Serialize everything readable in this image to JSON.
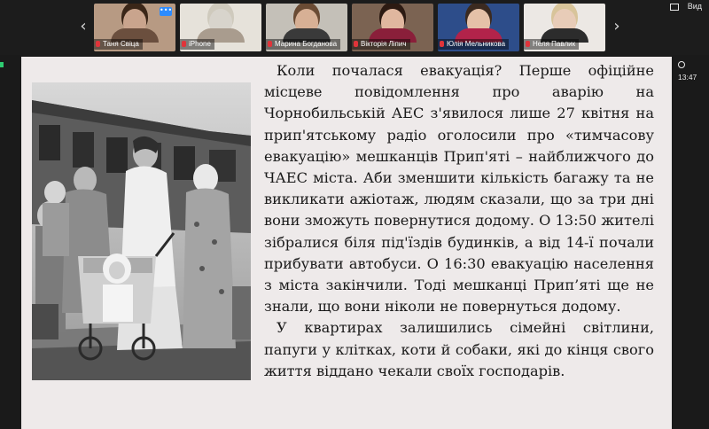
{
  "window": {
    "view_label": "Вид",
    "timer": "13:47"
  },
  "participants": [
    {
      "name": "Таня Свіца",
      "muted": true,
      "has_more_button": true,
      "skin": "#c9a48d",
      "hair": "#3a2618",
      "shirt": "#6b4f3e",
      "bg": "#b79a83"
    },
    {
      "name": "iPhone",
      "muted": true,
      "has_more_button": false,
      "skin": "#d8d4cc",
      "hair": "#cfcabd",
      "shirt": "#a99c8e",
      "bg": "#e6e2da"
    },
    {
      "name": "Марина Богданова",
      "muted": true,
      "has_more_button": false,
      "skin": "#d7b095",
      "hair": "#6a4b34",
      "shirt": "#3a3a3a",
      "bg": "#c4c0b8"
    },
    {
      "name": "Вікторія Ліпич",
      "muted": true,
      "has_more_button": false,
      "skin": "#e0b79f",
      "hair": "#2c1a12",
      "shirt": "#8a1f3a",
      "bg": "#7b6352"
    },
    {
      "name": "Юлія Мельникова",
      "muted": true,
      "has_more_button": false,
      "skin": "#e5c1a8",
      "hair": "#3b2a20",
      "shirt": "#b2234a",
      "bg": "#2d4d8a"
    },
    {
      "name": "Неля Павлик",
      "muted": true,
      "has_more_button": false,
      "skin": "#e8ccb8",
      "hair": "#d8c49a",
      "shirt": "#2c2c2c",
      "bg": "#ece8e4"
    }
  ],
  "slide": {
    "photo_description_icon": "black-and-white-photo",
    "paragraphs": [
      "Коли почалася евакуація? Перше офіційне місцеве повідомлення про аварію на Чорнобильській АЕС з'явилося лише 27 квітня на прип'ятському радіо оголосили про «тимчасову евакуацію» мешканців Прип'яті – найближчого до ЧАЕС міста. Аби зменшити кількість багажу та не викликати ажіотаж, людям сказали, що за три дні вони зможуть повернутися додому. О 13:50 жителі зібралися біля під'їздів будинків, а від 14-ї почали прибувати автобуси. О 16:30 евакуацію населення з міста закінчили. Тоді мешканці Прип’яті ще не знали, що вони ніколи не повернуться додому.",
      "У квартирах залишились сімейні світлини, папуги у клітках, коти й собаки, які  до кінця свого життя віддано чекали своїх господарів."
    ]
  }
}
